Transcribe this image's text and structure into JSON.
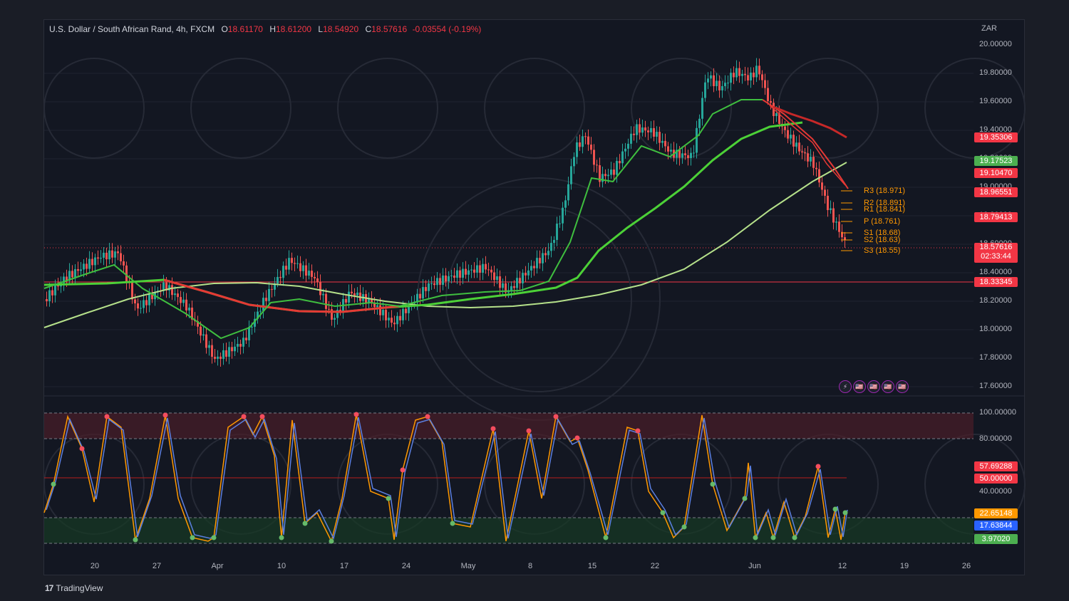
{
  "header": {
    "symbol": "U.S. Dollar / South African Rand, 4h, FXCM",
    "open_label": "O",
    "open": "18.61170",
    "high_label": "H",
    "high": "18.61200",
    "low_label": "L",
    "low": "18.54920",
    "close_label": "C",
    "close": "18.57616",
    "change": "-0.03554 (-0.19%)"
  },
  "currency": "ZAR",
  "price_axis": [
    "20.00000",
    "19.80000",
    "19.60000",
    "19.40000",
    "19.20000",
    "19.00000",
    "18.80000",
    "18.60000",
    "18.40000",
    "18.20000",
    "18.00000",
    "17.80000",
    "17.60000"
  ],
  "price_tags": [
    {
      "value": "19.35306",
      "color": "#f23645"
    },
    {
      "value": "19.17523",
      "color": "#4caf50"
    },
    {
      "value": "19.10470",
      "color": "#f23645"
    },
    {
      "value": "18.96551",
      "color": "#f23645"
    },
    {
      "value": "18.79413",
      "color": "#f23645"
    },
    {
      "value": "18.57616",
      "countdown": "02:33:44",
      "color": "#f23645"
    },
    {
      "value": "18.33345",
      "color": "#f23645"
    }
  ],
  "pivots": [
    "R3 (18.971)",
    "R2 (18.891)",
    "R1 (18.841)",
    "P (18.761)",
    "S1 (18.68)",
    "S2 (18.63)",
    "S3 (18.55)"
  ],
  "osc_axis": [
    "100.00000",
    "80.00000",
    "40.00000"
  ],
  "osc_tags": [
    {
      "value": "57.69288",
      "color": "#f23645"
    },
    {
      "value": "50.00000",
      "color": "#f23645"
    },
    {
      "value": "22.65148",
      "color": "#ff9800"
    },
    {
      "value": "17.63844",
      "color": "#2962ff"
    },
    {
      "value": "3.97020",
      "color": "#4caf50"
    }
  ],
  "time_axis": [
    "20",
    "27",
    "Apr",
    "10",
    "17",
    "24",
    "May",
    "8",
    "15",
    "22",
    "Jun",
    "12",
    "19",
    "26"
  ],
  "events": [
    "⚡",
    "🇺🇸",
    "🇺🇸",
    "🇺🇸",
    "🇺🇸"
  ],
  "branding": "TradingView",
  "colors": {
    "up": "#26a69a",
    "down": "#ef5350",
    "bg": "#131722"
  }
}
